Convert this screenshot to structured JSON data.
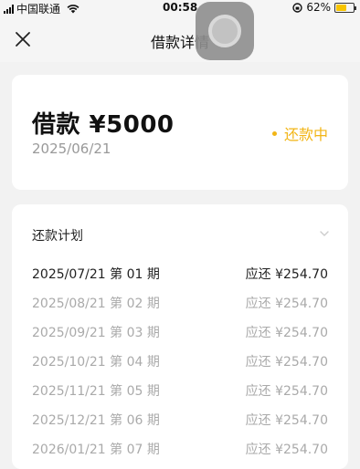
{
  "status_bar": {
    "carrier": "中国联通",
    "time": "00:58",
    "battery": "62%",
    "battery_level": 0.62
  },
  "nav": {
    "title": "借款详情"
  },
  "summary": {
    "loan_label": "借款 ¥5000",
    "date": "2025/06/21",
    "status": "还款中"
  },
  "plan": {
    "title": "还款计划",
    "rows": [
      {
        "date": "2025/07/21",
        "period": "第 01 期",
        "amount": "应还 ¥254.70",
        "active": true
      },
      {
        "date": "2025/08/21",
        "period": "第 02 期",
        "amount": "应还 ¥254.70",
        "active": false
      },
      {
        "date": "2025/09/21",
        "period": "第 03 期",
        "amount": "应还 ¥254.70",
        "active": false
      },
      {
        "date": "2025/10/21",
        "period": "第 04 期",
        "amount": "应还 ¥254.70",
        "active": false
      },
      {
        "date": "2025/11/21",
        "period": "第 05 期",
        "amount": "应还 ¥254.70",
        "active": false
      },
      {
        "date": "2025/12/21",
        "period": "第 06 期",
        "amount": "应还 ¥254.70",
        "active": false
      },
      {
        "date": "2026/01/21",
        "period": "第 07 期",
        "amount": "应还 ¥254.70",
        "active": false
      }
    ]
  },
  "colors": {
    "accent": "#f2b516",
    "background": "#f2f2f2"
  }
}
